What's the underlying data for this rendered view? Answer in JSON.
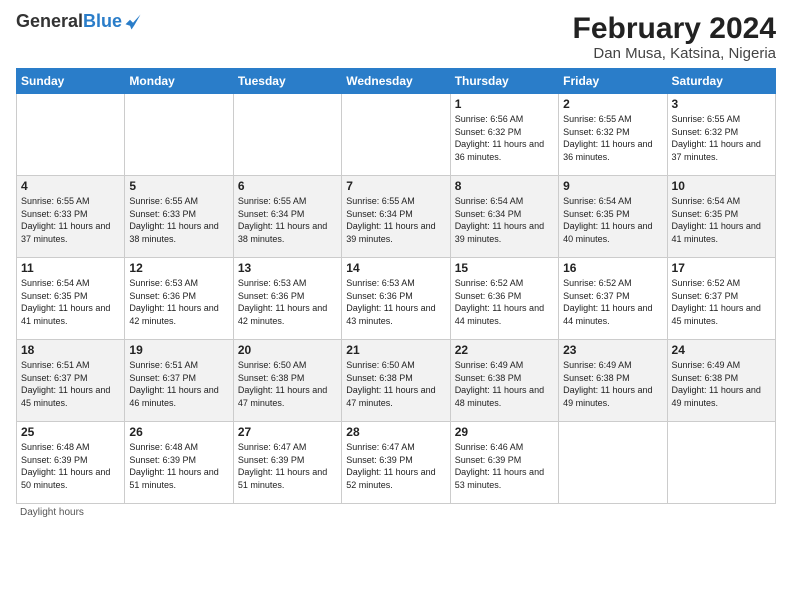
{
  "header": {
    "logo_general": "General",
    "logo_blue": "Blue",
    "main_title": "February 2024",
    "subtitle": "Dan Musa, Katsina, Nigeria"
  },
  "calendar": {
    "days_of_week": [
      "Sunday",
      "Monday",
      "Tuesday",
      "Wednesday",
      "Thursday",
      "Friday",
      "Saturday"
    ],
    "weeks": [
      [
        {
          "day": "",
          "info": ""
        },
        {
          "day": "",
          "info": ""
        },
        {
          "day": "",
          "info": ""
        },
        {
          "day": "",
          "info": ""
        },
        {
          "day": "1",
          "info": "Sunrise: 6:56 AM\nSunset: 6:32 PM\nDaylight: 11 hours\nand 36 minutes."
        },
        {
          "day": "2",
          "info": "Sunrise: 6:55 AM\nSunset: 6:32 PM\nDaylight: 11 hours\nand 36 minutes."
        },
        {
          "day": "3",
          "info": "Sunrise: 6:55 AM\nSunset: 6:32 PM\nDaylight: 11 hours\nand 37 minutes."
        }
      ],
      [
        {
          "day": "4",
          "info": "Sunrise: 6:55 AM\nSunset: 6:33 PM\nDaylight: 11 hours\nand 37 minutes."
        },
        {
          "day": "5",
          "info": "Sunrise: 6:55 AM\nSunset: 6:33 PM\nDaylight: 11 hours\nand 38 minutes."
        },
        {
          "day": "6",
          "info": "Sunrise: 6:55 AM\nSunset: 6:34 PM\nDaylight: 11 hours\nand 38 minutes."
        },
        {
          "day": "7",
          "info": "Sunrise: 6:55 AM\nSunset: 6:34 PM\nDaylight: 11 hours\nand 39 minutes."
        },
        {
          "day": "8",
          "info": "Sunrise: 6:54 AM\nSunset: 6:34 PM\nDaylight: 11 hours\nand 39 minutes."
        },
        {
          "day": "9",
          "info": "Sunrise: 6:54 AM\nSunset: 6:35 PM\nDaylight: 11 hours\nand 40 minutes."
        },
        {
          "day": "10",
          "info": "Sunrise: 6:54 AM\nSunset: 6:35 PM\nDaylight: 11 hours\nand 41 minutes."
        }
      ],
      [
        {
          "day": "11",
          "info": "Sunrise: 6:54 AM\nSunset: 6:35 PM\nDaylight: 11 hours\nand 41 minutes."
        },
        {
          "day": "12",
          "info": "Sunrise: 6:53 AM\nSunset: 6:36 PM\nDaylight: 11 hours\nand 42 minutes."
        },
        {
          "day": "13",
          "info": "Sunrise: 6:53 AM\nSunset: 6:36 PM\nDaylight: 11 hours\nand 42 minutes."
        },
        {
          "day": "14",
          "info": "Sunrise: 6:53 AM\nSunset: 6:36 PM\nDaylight: 11 hours\nand 43 minutes."
        },
        {
          "day": "15",
          "info": "Sunrise: 6:52 AM\nSunset: 6:36 PM\nDaylight: 11 hours\nand 44 minutes."
        },
        {
          "day": "16",
          "info": "Sunrise: 6:52 AM\nSunset: 6:37 PM\nDaylight: 11 hours\nand 44 minutes."
        },
        {
          "day": "17",
          "info": "Sunrise: 6:52 AM\nSunset: 6:37 PM\nDaylight: 11 hours\nand 45 minutes."
        }
      ],
      [
        {
          "day": "18",
          "info": "Sunrise: 6:51 AM\nSunset: 6:37 PM\nDaylight: 11 hours\nand 45 minutes."
        },
        {
          "day": "19",
          "info": "Sunrise: 6:51 AM\nSunset: 6:37 PM\nDaylight: 11 hours\nand 46 minutes."
        },
        {
          "day": "20",
          "info": "Sunrise: 6:50 AM\nSunset: 6:38 PM\nDaylight: 11 hours\nand 47 minutes."
        },
        {
          "day": "21",
          "info": "Sunrise: 6:50 AM\nSunset: 6:38 PM\nDaylight: 11 hours\nand 47 minutes."
        },
        {
          "day": "22",
          "info": "Sunrise: 6:49 AM\nSunset: 6:38 PM\nDaylight: 11 hours\nand 48 minutes."
        },
        {
          "day": "23",
          "info": "Sunrise: 6:49 AM\nSunset: 6:38 PM\nDaylight: 11 hours\nand 49 minutes."
        },
        {
          "day": "24",
          "info": "Sunrise: 6:49 AM\nSunset: 6:38 PM\nDaylight: 11 hours\nand 49 minutes."
        }
      ],
      [
        {
          "day": "25",
          "info": "Sunrise: 6:48 AM\nSunset: 6:39 PM\nDaylight: 11 hours\nand 50 minutes."
        },
        {
          "day": "26",
          "info": "Sunrise: 6:48 AM\nSunset: 6:39 PM\nDaylight: 11 hours\nand 51 minutes."
        },
        {
          "day": "27",
          "info": "Sunrise: 6:47 AM\nSunset: 6:39 PM\nDaylight: 11 hours\nand 51 minutes."
        },
        {
          "day": "28",
          "info": "Sunrise: 6:47 AM\nSunset: 6:39 PM\nDaylight: 11 hours\nand 52 minutes."
        },
        {
          "day": "29",
          "info": "Sunrise: 6:46 AM\nSunset: 6:39 PM\nDaylight: 11 hours\nand 53 minutes."
        },
        {
          "day": "",
          "info": ""
        },
        {
          "day": "",
          "info": ""
        }
      ]
    ]
  },
  "footer": {
    "note": "Daylight hours"
  }
}
